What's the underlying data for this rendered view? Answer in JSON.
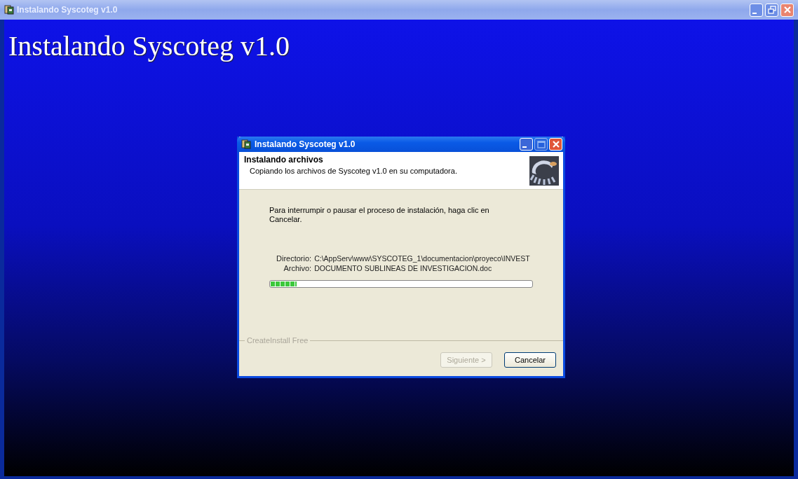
{
  "window": {
    "title": "Instalando Syscoteg v1.0",
    "controls": [
      {
        "kind": "minimize",
        "disabled": false
      },
      {
        "kind": "restore",
        "disabled": false
      },
      {
        "kind": "close",
        "disabled": false
      }
    ]
  },
  "banner": {
    "title": "Instalando Syscoteg v1.0"
  },
  "dialog": {
    "title": "Instalando Syscoteg v1.0",
    "controls": [
      {
        "kind": "minimize",
        "disabled": false
      },
      {
        "kind": "maximize",
        "disabled": true
      },
      {
        "kind": "close",
        "disabled": false
      }
    ],
    "header": {
      "title": "Instalando archivos",
      "subtitle": "Copiando los archivos de Syscoteg v1.0 en su computadora."
    },
    "message": "Para interrumpir o pausar el proceso de instalación, haga clic en Cancelar.",
    "fields": [
      {
        "label": "Directorio:",
        "value": "C:\\AppServ\\www\\SYSCOTEG_1\\documentacion\\proyeco\\INVEST"
      },
      {
        "label": "Archivo:",
        "value": "DOCUMENTO SUBLINEAS DE INVESTIGACION.doc"
      }
    ],
    "progress": {
      "level": 0.1
    },
    "footer_label": "CreateInstall Free",
    "buttons": [
      {
        "label": "Siguiente >",
        "disabled": true
      },
      {
        "label": "Cancelar",
        "disabled": false
      }
    ]
  }
}
